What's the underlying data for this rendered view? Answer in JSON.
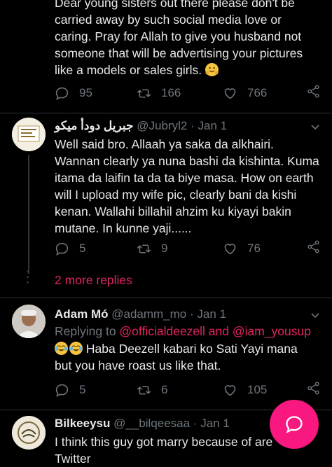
{
  "top_tweet": {
    "lines": [
      "Dear young sisters out there please don't be",
      "carried away by such social media love or",
      "caring. Pray for Allah to give you husband not",
      "someone that will be advertising your pictures",
      "like a models or sales girls."
    ],
    "emoji": "hugging-face",
    "reply_count": "95",
    "retweet_count": "166",
    "like_count": "766"
  },
  "reply1": {
    "name": "جبريل دودأ ميكو",
    "handle": "@Jubryl2",
    "separator": "·",
    "date": "Jan 1",
    "lines": [
      "Well said bro. Allaah ya saka da alkhairi.",
      "Wannan clearly ya nuna bashi da kishinta. Kuma",
      "itama da laifin ta da ta biye masa. How on earth",
      "will I upload my wife pic, clearly bani da kishi",
      "kenan. Wallahi billahil ahzim ku kiyayi bakin",
      "mutane. In kunne yaji......"
    ],
    "reply_count": "5",
    "retweet_count": "9",
    "like_count": "76"
  },
  "more_replies": "2 more replies",
  "reply2": {
    "name": "Adam Mó",
    "handle": "@adamm_mo",
    "separator": "·",
    "date": "Jan 1",
    "replying_prefix": "Replying to ",
    "replying_users": "@officialdeezell and @iam_yousup",
    "line1": "Haba Deezell kabari ko Sati Yayi mana",
    "line2": "but you have roast us like that.",
    "reply_count": "5",
    "retweet_count": "6",
    "like_count": "105"
  },
  "reply3": {
    "name": "Bilkeeysu",
    "handle": "@__bilqeesaa",
    "separator": "·",
    "date": "Jan 1",
    "line1": "I think this guy got  marry because of are",
    "line2": "Twitter"
  },
  "colors": {
    "accent": "#e0245e",
    "fab": "#f91880",
    "muted": "#6e767d"
  }
}
